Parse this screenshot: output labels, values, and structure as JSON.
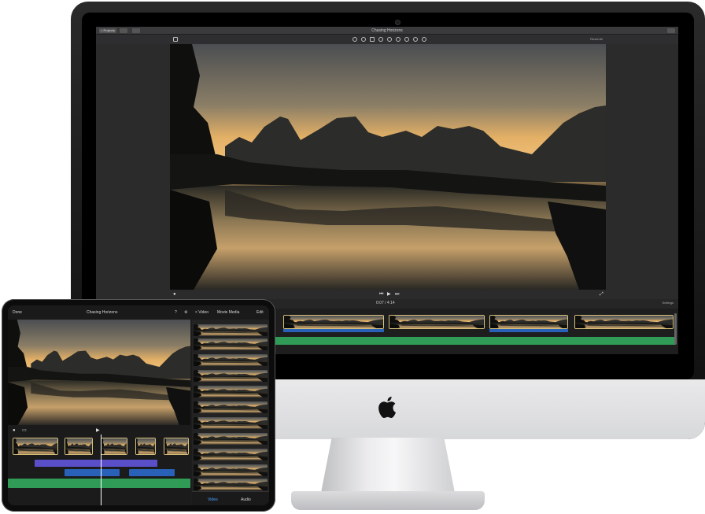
{
  "imac": {
    "back_label": "< Projects",
    "project_title": "Chasing Horizons",
    "reset_all_label": "Reset All",
    "timecode": "0:07 / 4:14",
    "settings_label": "Settings",
    "toolbar_icons": [
      "color-balance-icon",
      "color-correction-icon",
      "crop-icon",
      "stabilization-icon",
      "volume-icon",
      "noise-reduction-icon",
      "speed-icon",
      "clip-filter-icon",
      "info-icon"
    ],
    "playback_icons": {
      "prev": "⏮",
      "play": "▶",
      "next": "⏭"
    }
  },
  "ipad": {
    "done_label": "Done",
    "project_title": "Chasing Horizons",
    "edit_label": "Edit",
    "media_back_label": "< Video",
    "media_title": "Movie Media",
    "tabs": [
      "Video",
      "Audio"
    ]
  },
  "colors": {
    "audio_green": "#2f9b57",
    "clip_blue": "#2a61b8",
    "purple_track": "#5a4fc9",
    "clip_border": "#d9c27a"
  }
}
